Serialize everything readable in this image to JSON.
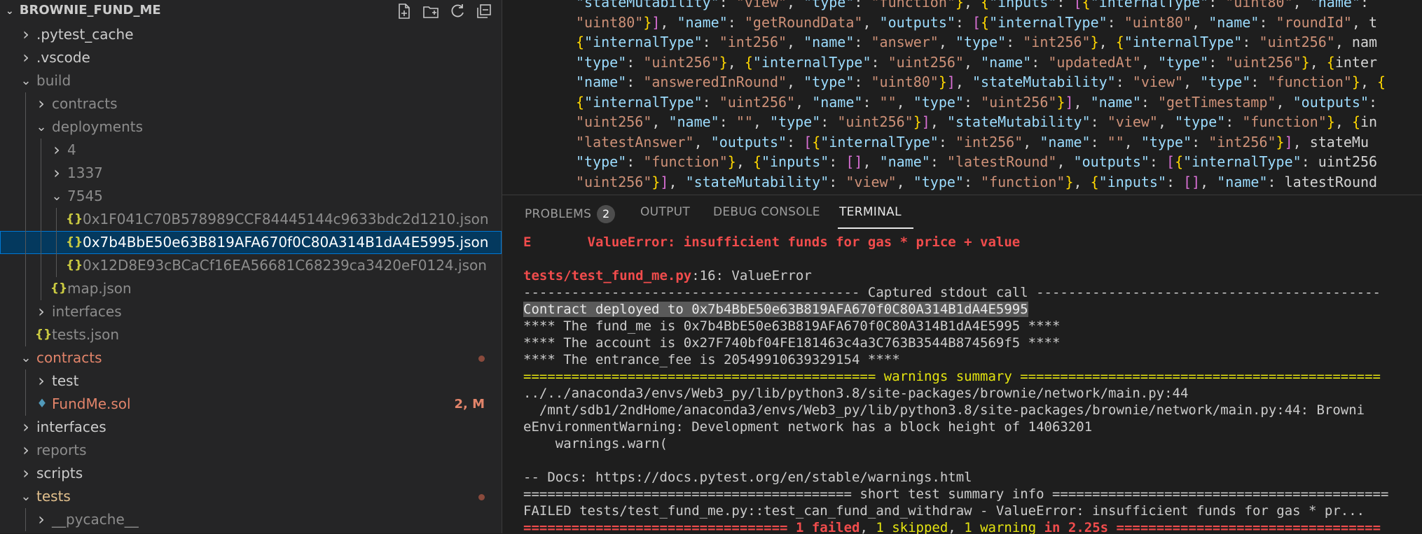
{
  "explorer": {
    "title": "BROWNIE_FUND_ME",
    "actions": [
      "new-file-icon",
      "new-folder-icon",
      "refresh-icon",
      "collapse-all-icon"
    ],
    "items": [
      {
        "label": ".pytest_cache",
        "type": "folder",
        "expanded": false,
        "depth": 1,
        "style": "normal"
      },
      {
        "label": ".vscode",
        "type": "folder",
        "expanded": false,
        "depth": 1,
        "style": "normal"
      },
      {
        "label": "build",
        "type": "folder",
        "expanded": true,
        "depth": 1,
        "style": "dim"
      },
      {
        "label": "contracts",
        "type": "folder",
        "expanded": false,
        "depth": 2,
        "style": "dim"
      },
      {
        "label": "deployments",
        "type": "folder",
        "expanded": true,
        "depth": 2,
        "style": "dim"
      },
      {
        "label": "4",
        "type": "folder",
        "expanded": false,
        "depth": 3,
        "style": "dim"
      },
      {
        "label": "1337",
        "type": "folder",
        "expanded": false,
        "depth": 3,
        "style": "dim"
      },
      {
        "label": "7545",
        "type": "folder",
        "expanded": true,
        "depth": 3,
        "style": "dim"
      },
      {
        "label": "0x1F041C70B578989CCF84445144c9633bdc2d1210.json",
        "type": "json",
        "depth": 4,
        "style": "dim"
      },
      {
        "label": "0x7b4BbE50e63B819AFA670f0C80A314B1dA4E5995.json",
        "type": "json",
        "depth": 4,
        "style": "normal",
        "selected": true
      },
      {
        "label": "0x12D8E93cBCaCf16EA56681C68239ca3420eF0124.json",
        "type": "json",
        "depth": 4,
        "style": "dim"
      },
      {
        "label": "map.json",
        "type": "json",
        "depth": 3,
        "style": "dim"
      },
      {
        "label": "interfaces",
        "type": "folder",
        "expanded": false,
        "depth": 2,
        "style": "dim"
      },
      {
        "label": "tests.json",
        "type": "json",
        "depth": 2,
        "style": "dim"
      },
      {
        "label": "contracts",
        "type": "folder",
        "expanded": true,
        "depth": 1,
        "style": "modified",
        "dot": true
      },
      {
        "label": "test",
        "type": "folder",
        "expanded": false,
        "depth": 2,
        "style": "normal"
      },
      {
        "label": "FundMe.sol",
        "type": "sol",
        "depth": 2,
        "style": "modified",
        "badge": "2, M"
      },
      {
        "label": "interfaces",
        "type": "folder",
        "expanded": false,
        "depth": 1,
        "style": "normal"
      },
      {
        "label": "reports",
        "type": "folder",
        "expanded": false,
        "depth": 1,
        "style": "dim"
      },
      {
        "label": "scripts",
        "type": "folder",
        "expanded": false,
        "depth": 1,
        "style": "normal"
      },
      {
        "label": "tests",
        "type": "folder",
        "expanded": true,
        "depth": 1,
        "style": "tests",
        "dot": true
      },
      {
        "label": "__pycache__",
        "type": "folder",
        "expanded": false,
        "depth": 2,
        "style": "dim"
      }
    ]
  },
  "editor": {
    "lines": [
      "\"stateMutability\": \"view\", \"type\": \"function\"}, {\"inputs\": [{\"internalType\": \"uint80\", \"name\": \"",
      "\"uint80\"}], \"name\": \"getRoundData\", \"outputs\": [{\"internalType\": \"uint80\", \"name\": \"roundId\", \"t",
      "{\"internalType\": \"int256\", \"name\": \"answer\", \"type\": \"int256\"}, {\"internalType\": \"uint256\", \"nam",
      "\"type\": \"uint256\"}, {\"internalType\": \"uint256\", \"name\": \"updatedAt\", \"type\": \"uint256\"}, {\"inter",
      "\"name\": \"answeredInRound\", \"type\": \"uint80\"}], \"stateMutability\": \"view\", \"type\": \"function\"}, {",
      "{\"internalType\": \"uint256\", \"name\": \"\", \"type\": \"uint256\"}], \"name\": \"getTimestamp\", \"outputs\":",
      "\"uint256\", \"name\": \"\", \"type\": \"uint256\"}], \"stateMutability\": \"view\", \"type\": \"function\"}, {\"in",
      "\"latestAnswer\", \"outputs\": [{\"internalType\": \"int256\", \"name\": \"\", \"type\": \"int256\"}], \"stateMu",
      "\"type\": \"function\"}, {\"inputs\": [], \"name\": \"latestRound\", \"outputs\": [{\"internalType\": \"uint256",
      "\"uint256\"}], \"stateMutability\": \"view\", \"type\": \"function\"}, {\"inputs\": [], \"name\": \"latestRound",
      "{\"internalType\": \"uint80\", \"name\": \"roundId\", \"type\": \"uint80\"}, {\"internalType\": \"int256\", \"n"
    ]
  },
  "panel": {
    "tabs": [
      {
        "label": "PROBLEMS",
        "count": "2",
        "active": false
      },
      {
        "label": "OUTPUT",
        "active": false
      },
      {
        "label": "DEBUG CONSOLE",
        "active": false
      },
      {
        "label": "TERMINAL",
        "active": true
      }
    ],
    "terminal": [
      {
        "segments": [
          {
            "text": "E       ValueError: insufficient funds for gas * price + value",
            "style": "red"
          }
        ]
      },
      {
        "segments": [
          {
            "text": "",
            "style": "normal"
          }
        ]
      },
      {
        "segments": [
          {
            "text": "tests/test_fund_me.py",
            "style": "red"
          },
          {
            "text": ":16: ValueError",
            "style": "normal"
          }
        ]
      },
      {
        "segments": [
          {
            "text": "------------------------------------------ Captured stdout call -------------------------------------------",
            "style": "normal"
          }
        ]
      },
      {
        "segments": [
          {
            "text": "Contract deployed to 0x7b4BbE50e63B819AFA670f0C80A314B1dA4E5995",
            "style": "highlight"
          }
        ]
      },
      {
        "segments": [
          {
            "text": "**** The fund_me is 0x7b4BbE50e63B819AFA670f0C80A314B1dA4E5995 ****",
            "style": "normal"
          }
        ]
      },
      {
        "segments": [
          {
            "text": "**** The account is 0x27F740bf04FE181463c4a3C763B3544B874569f5 ****",
            "style": "normal"
          }
        ]
      },
      {
        "segments": [
          {
            "text": "**** The entrance_fee is 20549910639329154 ****",
            "style": "normal"
          }
        ]
      },
      {
        "segments": [
          {
            "text": "============================================ warnings summary =============================================",
            "style": "yellow"
          }
        ]
      },
      {
        "segments": [
          {
            "text": "../../anaconda3/envs/Web3_py/lib/python3.8/site-packages/brownie/network/main.py:44",
            "style": "normal"
          }
        ]
      },
      {
        "segments": [
          {
            "text": "  /mnt/sdb1/2ndHome/anaconda3/envs/Web3_py/lib/python3.8/site-packages/brownie/network/main.py:44: Browni",
            "style": "normal"
          }
        ]
      },
      {
        "segments": [
          {
            "text": "eEnvironmentWarning: Development network has a block height of 14063201",
            "style": "normal"
          }
        ]
      },
      {
        "segments": [
          {
            "text": "    warnings.warn(",
            "style": "normal"
          }
        ]
      },
      {
        "segments": [
          {
            "text": "",
            "style": "normal"
          }
        ]
      },
      {
        "segments": [
          {
            "text": "-- Docs: https://docs.pytest.org/en/stable/warnings.html",
            "style": "normal"
          }
        ]
      },
      {
        "segments": [
          {
            "text": "========================================= short test summary info ==========================================",
            "style": "normal"
          }
        ]
      },
      {
        "segments": [
          {
            "text": "FAILED tests/test_fund_me.py::test_can_fund_and_withdraw - ValueError: insufficient funds for gas * pr...",
            "style": "normal"
          }
        ]
      },
      {
        "segments": [
          {
            "text": "================================= ",
            "style": "red"
          },
          {
            "text": "1 failed",
            "style": "red"
          },
          {
            "text": ", ",
            "style": "normal"
          },
          {
            "text": "1 skipped",
            "style": "yellow"
          },
          {
            "text": ", ",
            "style": "normal"
          },
          {
            "text": "1 warning",
            "style": "yellow"
          },
          {
            "text": " in 2.25s =================================",
            "style": "red"
          }
        ]
      }
    ]
  }
}
